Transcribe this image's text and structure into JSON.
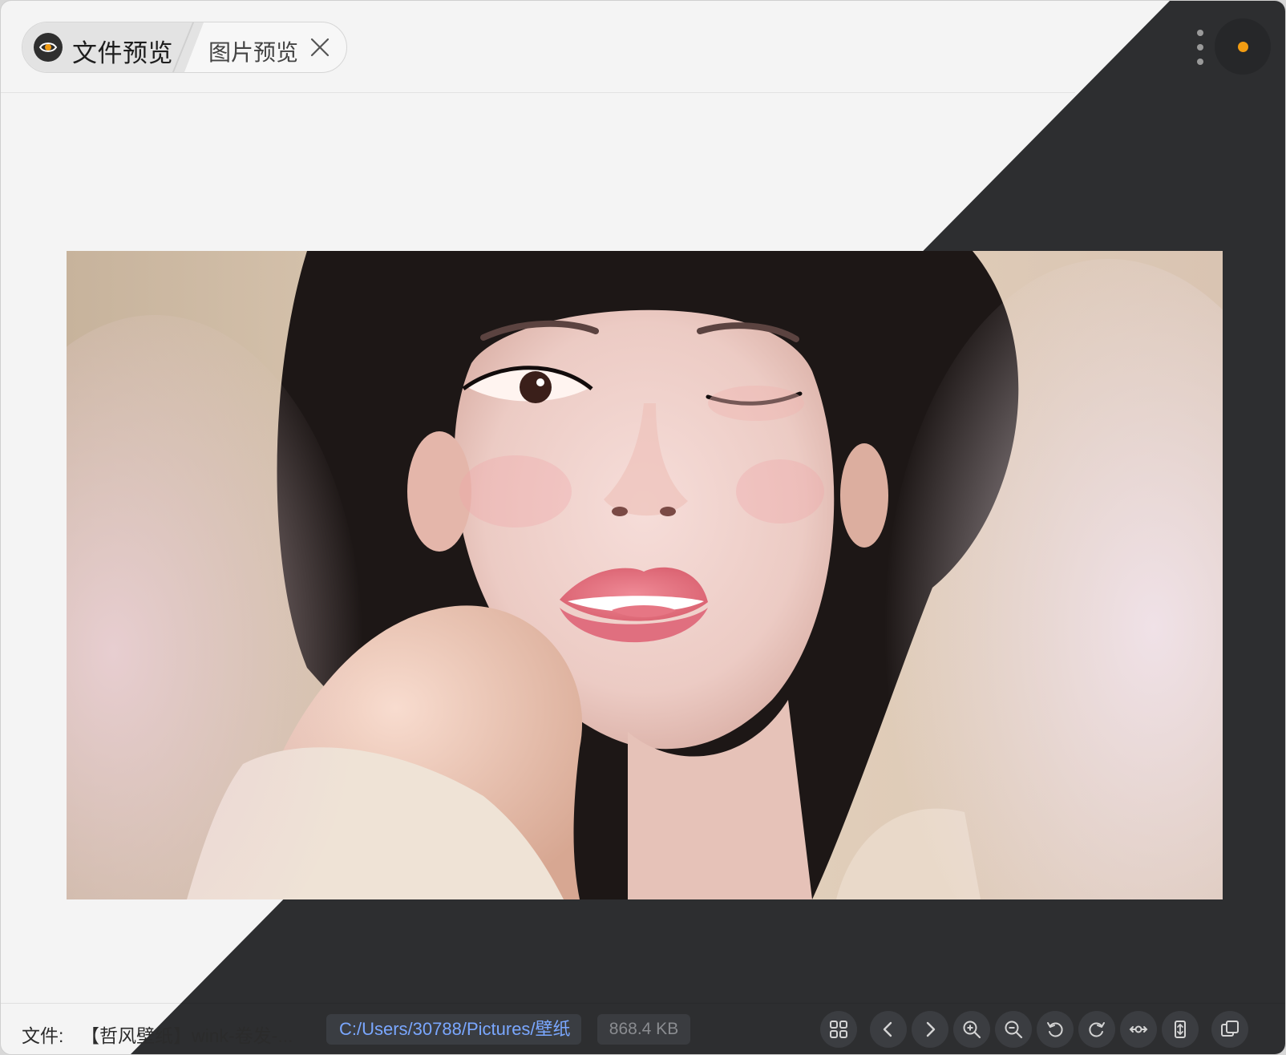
{
  "window": {
    "tabs": [
      {
        "label": "文件预览",
        "icon": "eye-icon",
        "active": true
      },
      {
        "label": "图片预览",
        "icon": "close-icon",
        "active": false
      }
    ],
    "menu_icon": "more-vertical-icon",
    "status_color": "#f29c12"
  },
  "preview": {
    "content": "photo"
  },
  "footer": {
    "file_label": "文件:",
    "file_name": "【哲风壁纸】wink-卷发-...",
    "path": "C:/Users/30788/Pictures/壁纸",
    "size": "868.4 KB",
    "tools": [
      "grid-view-icon",
      "previous-icon",
      "next-icon",
      "zoom-in-icon",
      "zoom-out-icon",
      "rotate-left-icon",
      "rotate-right-icon",
      "fit-width-icon",
      "fit-height-icon",
      "copy-icon"
    ]
  },
  "colors": {
    "light_panel": "#f4f4f4",
    "dark_panel": "#2d2e30",
    "path_link": "#7aa7ff",
    "accent_orange": "#f29c12"
  }
}
